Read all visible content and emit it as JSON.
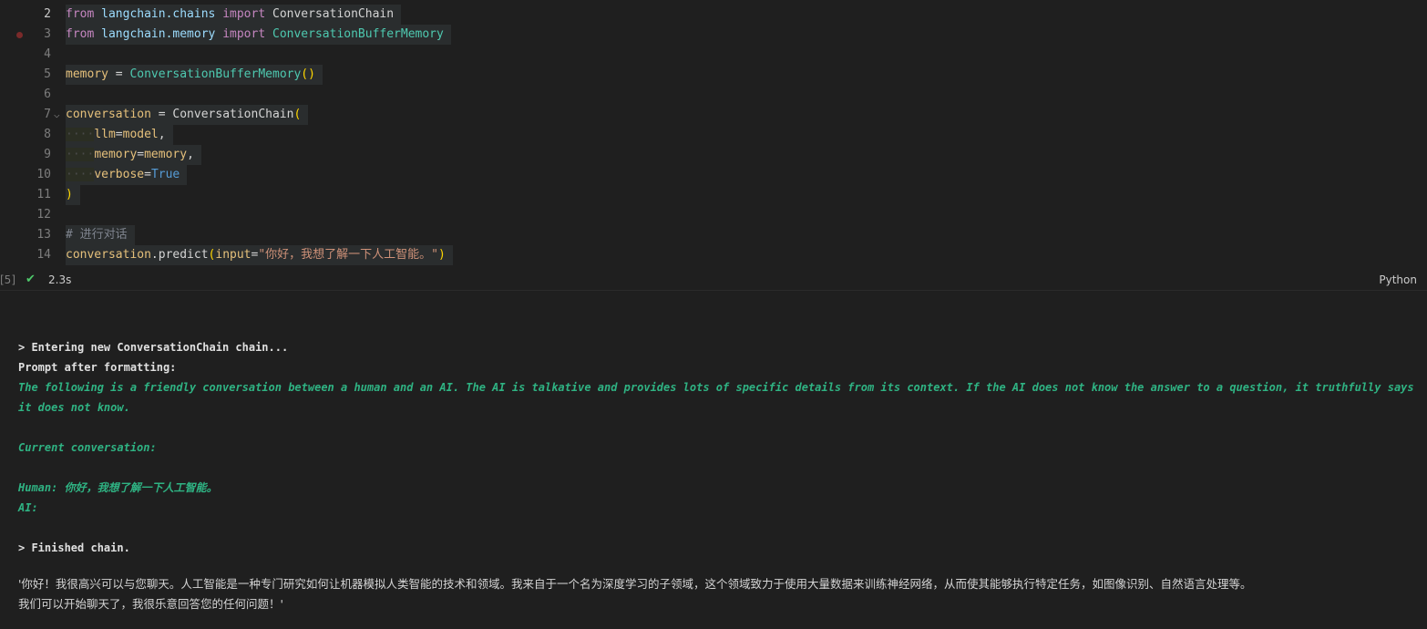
{
  "editor": {
    "lines": [
      {
        "num": "2",
        "tokens": [
          {
            "t": "from",
            "c": "kw"
          },
          {
            "t": " ",
            "c": "ws"
          },
          {
            "t": "langchain.chains",
            "c": "mod"
          },
          {
            "t": " ",
            "c": "ws"
          },
          {
            "t": "import",
            "c": "kw"
          },
          {
            "t": " ",
            "c": "ws"
          },
          {
            "t": "ConversationChain",
            "c": "plain"
          }
        ]
      },
      {
        "num": "3",
        "tokens": [
          {
            "t": "from",
            "c": "kw"
          },
          {
            "t": " ",
            "c": "ws"
          },
          {
            "t": "langchain.memory",
            "c": "mod"
          },
          {
            "t": " ",
            "c": "ws"
          },
          {
            "t": "import",
            "c": "kw"
          },
          {
            "t": " ",
            "c": "ws"
          },
          {
            "t": "ConversationBufferMemory",
            "c": "cls"
          }
        ]
      },
      {
        "num": "4",
        "tokens": []
      },
      {
        "num": "5",
        "tokens": [
          {
            "t": "memory",
            "c": "var"
          },
          {
            "t": " = ",
            "c": "plain"
          },
          {
            "t": "ConversationBufferMemory",
            "c": "cls"
          },
          {
            "t": "()",
            "c": "paren"
          }
        ]
      },
      {
        "num": "6",
        "tokens": []
      },
      {
        "num": "7",
        "tokens": [
          {
            "t": "conversation",
            "c": "var"
          },
          {
            "t": " = ",
            "c": "plain"
          },
          {
            "t": "ConversationChain",
            "c": "plain"
          },
          {
            "t": "(",
            "c": "paren"
          }
        ]
      },
      {
        "num": "8",
        "tokens": [
          {
            "t": "····",
            "c": "ws"
          },
          {
            "t": "llm",
            "c": "param"
          },
          {
            "t": "=",
            "c": "plain"
          },
          {
            "t": "model",
            "c": "var"
          },
          {
            "t": ",",
            "c": "plain"
          }
        ]
      },
      {
        "num": "9",
        "tokens": [
          {
            "t": "····",
            "c": "ws"
          },
          {
            "t": "memory",
            "c": "param"
          },
          {
            "t": "=",
            "c": "plain"
          },
          {
            "t": "memory",
            "c": "var"
          },
          {
            "t": ",",
            "c": "plain"
          }
        ]
      },
      {
        "num": "10",
        "tokens": [
          {
            "t": "····",
            "c": "ws"
          },
          {
            "t": "verbose",
            "c": "param"
          },
          {
            "t": "=",
            "c": "plain"
          },
          {
            "t": "True",
            "c": "const"
          }
        ]
      },
      {
        "num": "11",
        "tokens": [
          {
            "t": ")",
            "c": "paren"
          }
        ]
      },
      {
        "num": "12",
        "tokens": []
      },
      {
        "num": "13",
        "tokens": [
          {
            "t": "# 进行对话",
            "c": "cmt"
          }
        ]
      },
      {
        "num": "14",
        "tokens": [
          {
            "t": "conversation",
            "c": "var"
          },
          {
            "t": ".predict",
            "c": "plain"
          },
          {
            "t": "(",
            "c": "paren"
          },
          {
            "t": "input",
            "c": "param"
          },
          {
            "t": "=",
            "c": "plain"
          },
          {
            "t": "\"你好，我想了解一下人工智能。\"",
            "c": "str"
          },
          {
            "t": ")",
            "c": "paren"
          }
        ]
      }
    ]
  },
  "status": {
    "bracket": "[5]",
    "time": "2.3s",
    "language": "Python"
  },
  "output": {
    "entering": "> Entering new ConversationChain chain...",
    "prompt_after": "Prompt after formatting:",
    "intro_line1": "The following is a friendly conversation between a human and an AI. The AI is talkative and provides lots of specific details from its context. If the AI does not know the answer to a question, it truthfully says",
    "intro_line2": "it does not know.",
    "current_conv": "Current conversation:",
    "human": "Human: 你好，我想了解一下人工智能。",
    "ai": "AI:",
    "finished": "> Finished chain.",
    "result_line1": "'你好！我很高兴可以与您聊天。人工智能是一种专门研究如何让机器模拟人类智能的技术和领域。我来自于一个名为深度学习的子领域，这个领域致力于使用大量数据来训练神经网络，从而使其能够执行特定任务，如图像识别、自然语言处理等。",
    "result_line2": "我们可以开始聊天了，我很乐意回答您的任何问题！'"
  },
  "colors": {
    "background": "#1f1f1f",
    "output_green": "#2fb383",
    "check": "#4ec96b"
  }
}
